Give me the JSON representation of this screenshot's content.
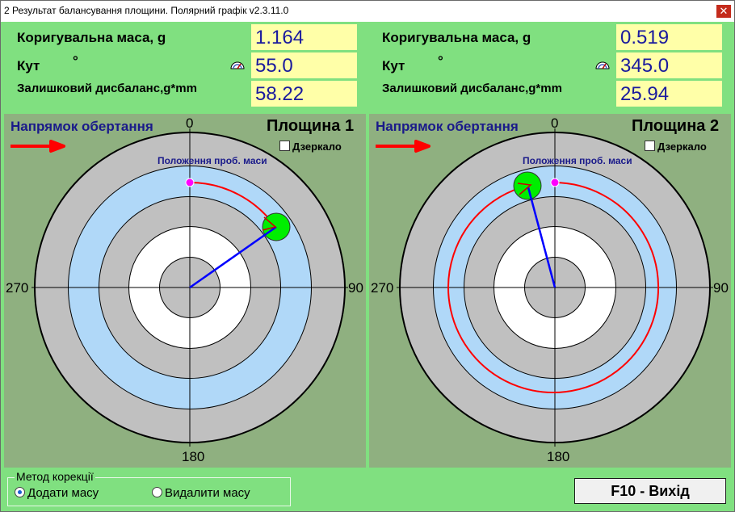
{
  "window": {
    "title": "2 Результат балансування площини. Полярний графік v2.3.11.0",
    "close": "✕"
  },
  "labels": {
    "mass": "Коригувальна маса, g",
    "angle": "Кут",
    "degree": "°",
    "residual": "Залишковий дисбаланс,g*mm",
    "rotation": "Напрямок обертання",
    "mirror": "Дзеркало",
    "probe": "Положення проб. маси",
    "ang0": "0",
    "ang90": "90",
    "ang180": "180",
    "ang270": "270"
  },
  "planes": [
    {
      "title": "Площина 1",
      "mass": "1.164",
      "angle": "55.0",
      "residual": "58.22"
    },
    {
      "title": "Площина 2",
      "mass": "0.519",
      "angle": "345.0",
      "residual": "25.94"
    }
  ],
  "method": {
    "legend": "Метод корекції",
    "add": "Додати масу",
    "remove": "Видалити масу",
    "selected": "add"
  },
  "exit_button": "F10 - Вихід",
  "colors": {
    "background": "#80e080",
    "plot_background": "#8fb080",
    "value_box": "#ffffa8",
    "value_text": "#1a1a9e",
    "ring_gray": "#c0c0c0",
    "ring_blue": "#b0d8f8",
    "vector": "#0000ff",
    "arc": "#ff0000",
    "mass_marker": "#00ff00",
    "probe_marker": "#ff00ff"
  },
  "icons": {
    "gauge": "gauge-icon",
    "rotation_arrow": "arrow-right-icon"
  }
}
